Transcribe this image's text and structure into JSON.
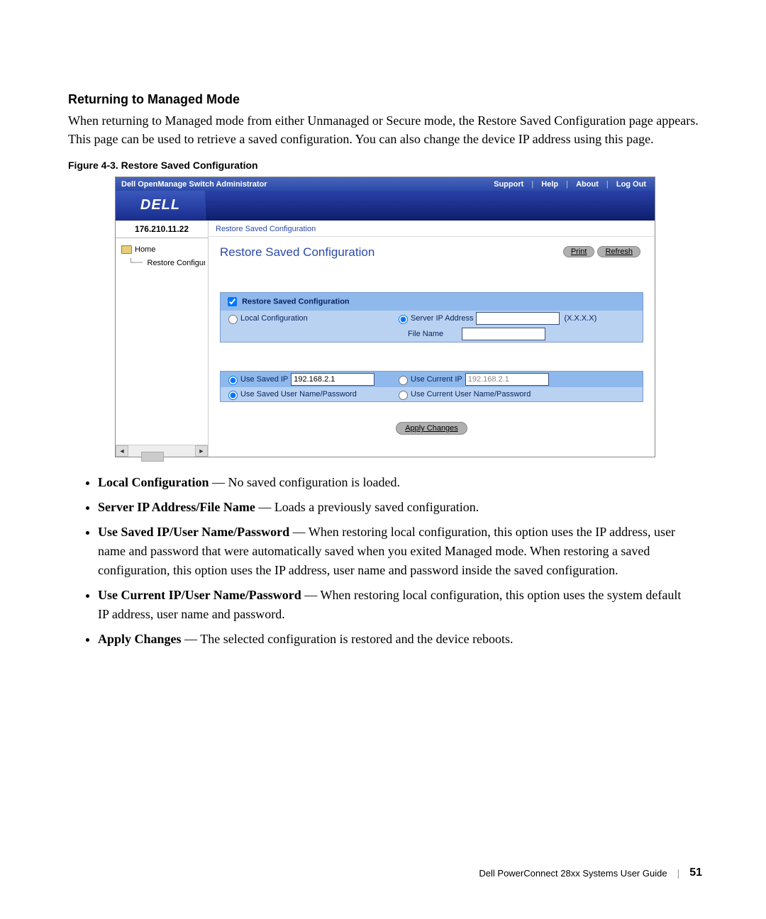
{
  "section": {
    "heading": "Returning to Managed Mode",
    "paragraph": "When returning to Managed mode from either Unmanaged or Secure mode, the Restore Saved Configuration page appears. This page can be used to retrieve a saved configuration. You can also change the device IP address using this page."
  },
  "figure": {
    "caption": "Figure 4-3.    Restore Saved Configuration"
  },
  "screenshot": {
    "titlebar": {
      "title": "Dell OpenManage Switch Administrator",
      "links": [
        "Support",
        "Help",
        "About",
        "Log Out"
      ]
    },
    "logo_text": "DELL",
    "sidebar": {
      "ip": "176.210.11.22",
      "tree_root": "Home",
      "tree_leaf": "Restore Configurati"
    },
    "main": {
      "breadcrumb": "Restore Saved Configuration",
      "page_title": "Restore Saved Configuration",
      "buttons": {
        "print": "Print",
        "refresh": "Refresh"
      },
      "panel1": {
        "header": "Restore Saved Configuration",
        "local_label": "Local Configuration",
        "server_ip_label": "Server IP Address",
        "server_ip_hint": "(X.X.X.X)",
        "file_name_label": "File Name"
      },
      "panel2": {
        "use_saved_ip_label": "Use Saved IP",
        "use_saved_ip_value": "192.168.2.1",
        "use_current_ip_label": "Use Current IP",
        "use_current_ip_value": "192.168.2.1",
        "use_saved_creds": "Use Saved User Name/Password",
        "use_current_creds": "Use Current User Name/Password"
      },
      "apply_label": "Apply Changes"
    }
  },
  "bullets": [
    {
      "term": "Local Configuration",
      "desc": " — No saved configuration is loaded."
    },
    {
      "term": "Server IP Address/File Name",
      "desc": " — Loads a previously saved configuration."
    },
    {
      "term": "Use Saved IP/User Name/Password",
      "desc": " — When restoring local configuration, this option uses the IP address, user name and password that were automatically saved when you exited Managed mode. When restoring a saved configuration, this option uses the IP address, user name and password inside the saved configuration."
    },
    {
      "term": "Use Current IP/User Name/Password",
      "desc": " — When restoring local configuration, this option uses the system default IP address, user name and password."
    },
    {
      "term": "Apply Changes",
      "desc": " — The selected configuration is restored and the device reboots."
    }
  ],
  "footer": {
    "guide": "Dell PowerConnect 28xx Systems User Guide",
    "page": "51"
  }
}
